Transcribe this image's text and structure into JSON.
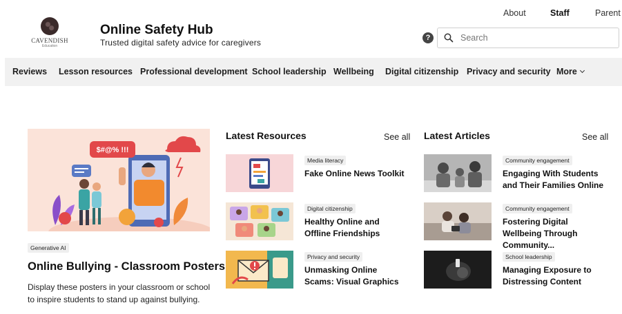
{
  "top_links": {
    "about": "About",
    "staff": "Staff",
    "parent": "Parent"
  },
  "logo": {
    "word": "CAVENDISH",
    "sub": "Education"
  },
  "site": {
    "title": "Online Safety Hub",
    "tagline": "Trusted digital safety advice for caregivers"
  },
  "search": {
    "placeholder": "Search"
  },
  "help": {
    "glyph": "?"
  },
  "nav": {
    "items": [
      "Reviews",
      "Lesson resources",
      "Professional development",
      "School leadership",
      "Wellbeing",
      "Digital citizenship",
      "Privacy and security"
    ],
    "more": "More"
  },
  "feature": {
    "tag": "Generative AI",
    "title": "Online Bullying - Classroom Posters",
    "description": "Display these posters in your classroom or school to inspire students to stand up against bullying.",
    "speech": "$#@% !!!"
  },
  "resources": {
    "heading": "Latest Resources",
    "see_all": "See all",
    "items": [
      {
        "tag": "Media literacy",
        "title": "Fake Online News Toolkit"
      },
      {
        "tag": "Digital citizenship",
        "title": "Healthy Online and Offline Friendships"
      },
      {
        "tag": "Privacy and security",
        "title": "Unmasking Online Scams: Visual Graphics"
      }
    ]
  },
  "articles": {
    "heading": "Latest Articles",
    "see_all": "See all",
    "items": [
      {
        "tag": "Community engagement",
        "title": "Engaging With Students and Their Families Online"
      },
      {
        "tag": "Community engagement",
        "title": "Fostering Digital Wellbeing Through Community..."
      },
      {
        "tag": "School leadership",
        "title": "Managing Exposure to Distressing Content"
      }
    ]
  },
  "colors": {
    "nav_bg": "#f1f1f1",
    "feature_bg": "#fbe3d9",
    "accent_red": "#e2484a"
  }
}
